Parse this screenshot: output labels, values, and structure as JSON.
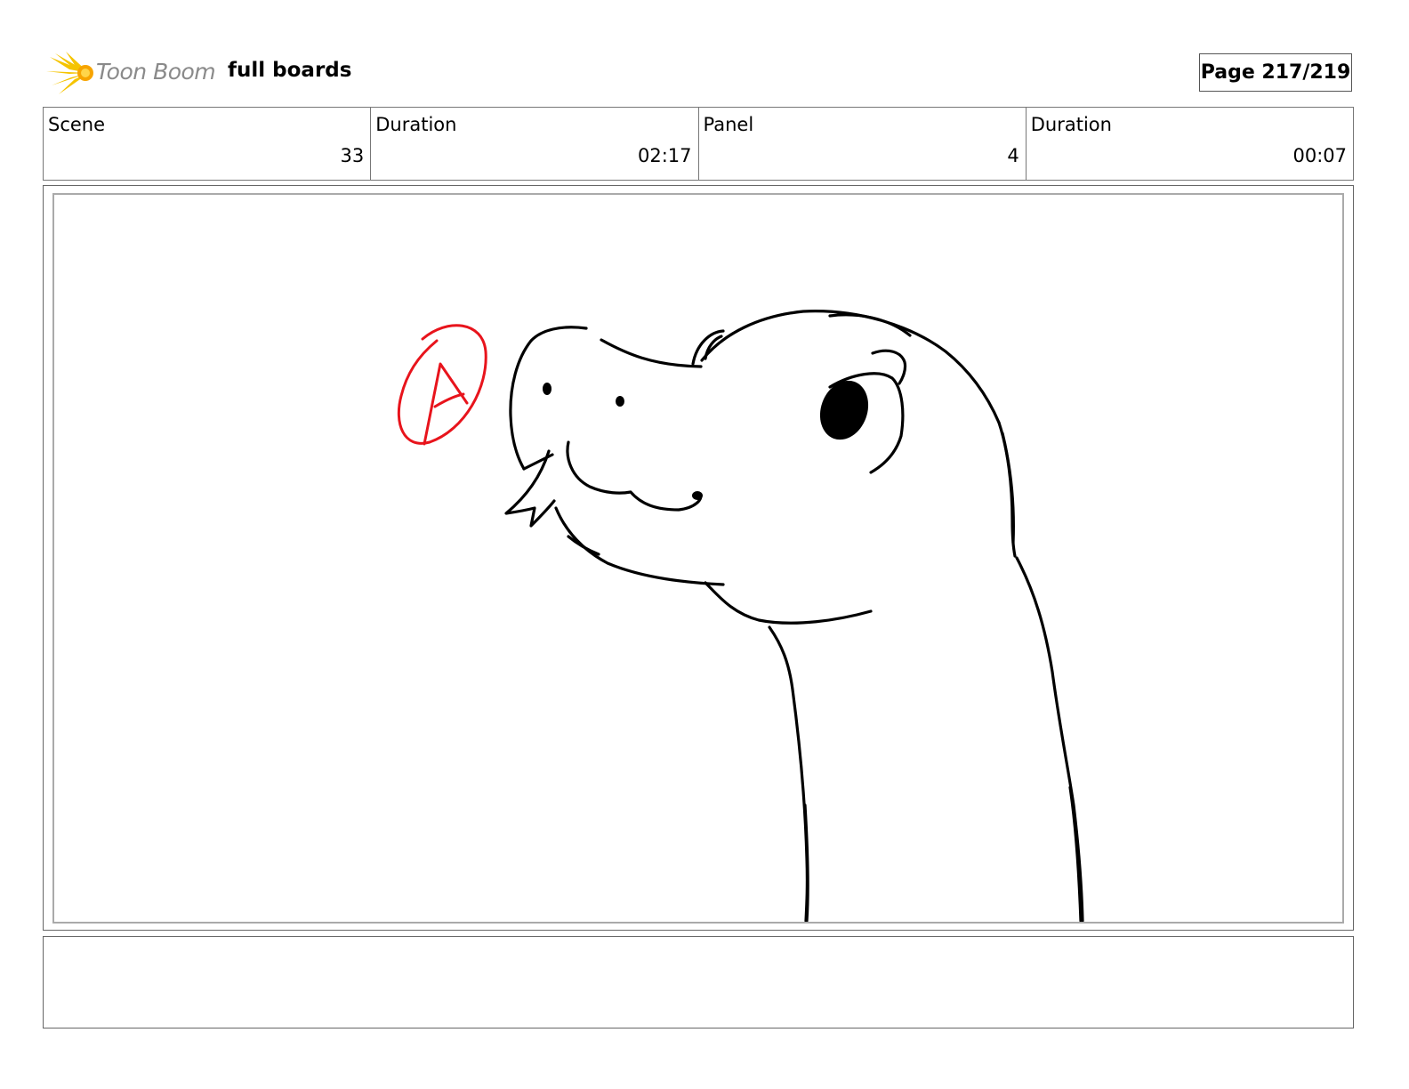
{
  "header": {
    "logo_text": "Toon Boom",
    "title": "full boards",
    "page_label": "Page 217/219"
  },
  "info": [
    {
      "label": "Scene",
      "value": "33"
    },
    {
      "label": "Duration",
      "value": "02:17"
    },
    {
      "label": "Panel",
      "value": "4"
    },
    {
      "label": "Duration",
      "value": "00:07"
    }
  ],
  "panel": {
    "annotation_letter": "A",
    "annotation_color": "#e8141c",
    "line_color": "#000000"
  },
  "notes": {
    "text": ""
  },
  "colors": {
    "logo_yellow": "#f5c400",
    "logo_text": "#8a8a8a",
    "border": "#777777"
  },
  "icons": [
    "toon-boom-logo-icon"
  ]
}
